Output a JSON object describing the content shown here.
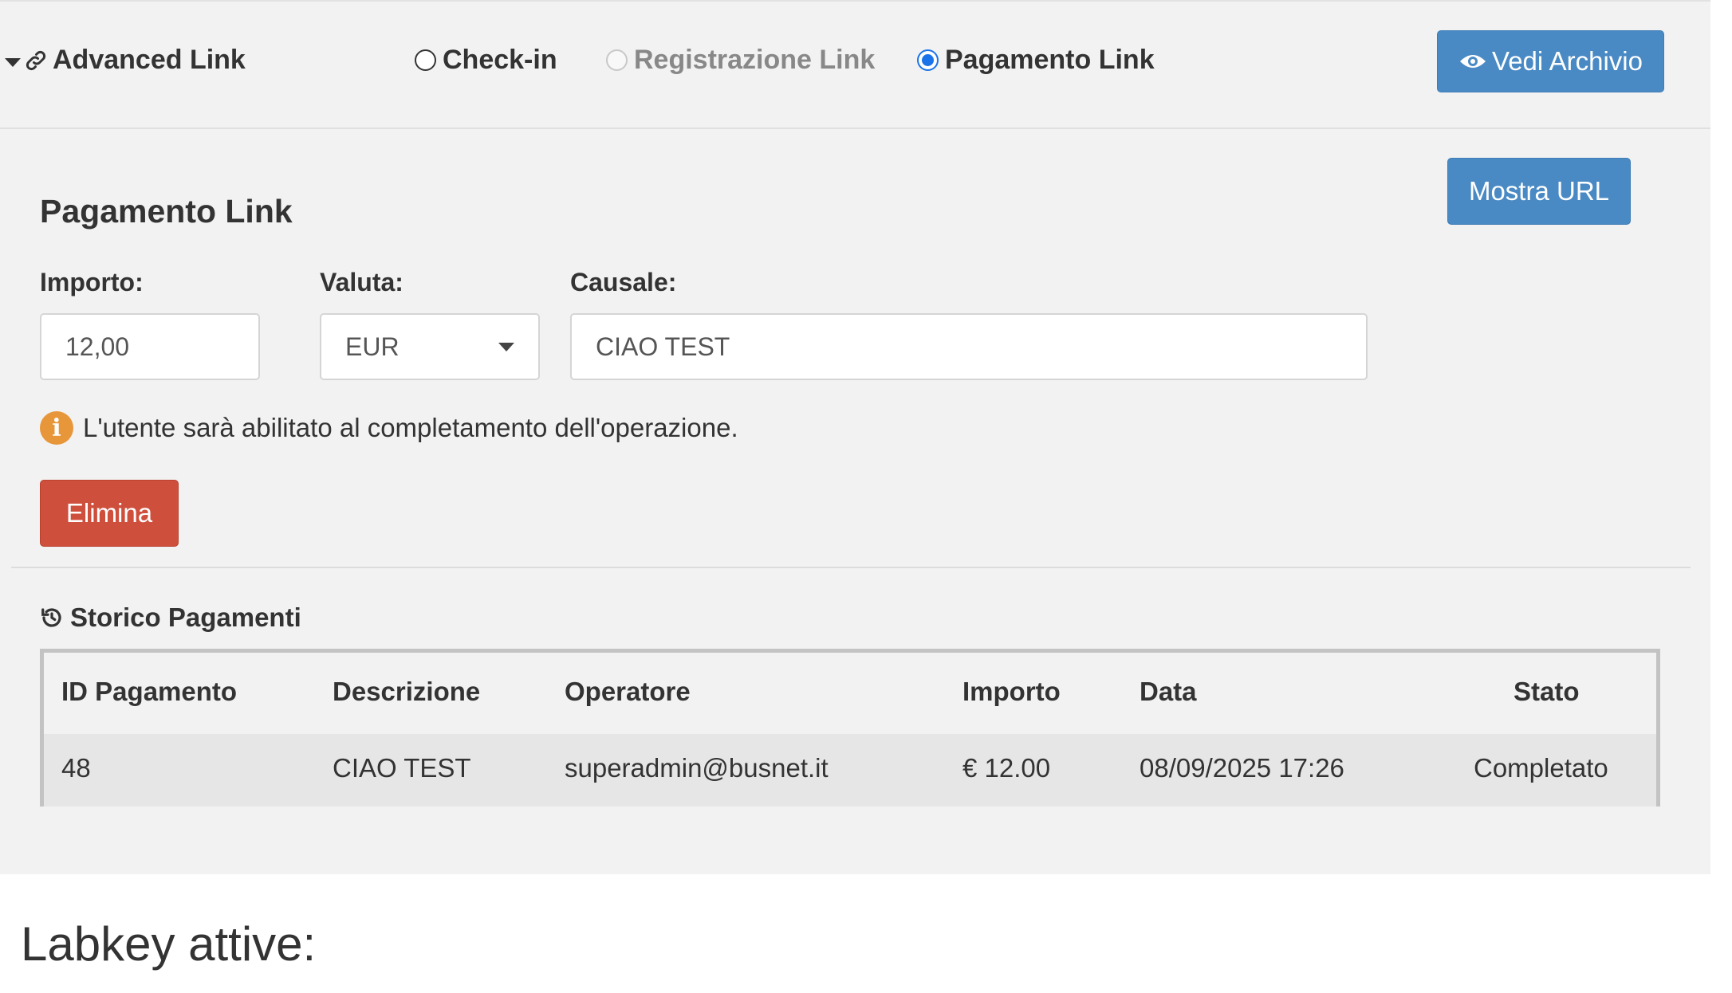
{
  "header": {
    "title": "Advanced Link",
    "options": [
      {
        "label": "Check-in",
        "state": "unchecked"
      },
      {
        "label": "Registrazione Link",
        "state": "disabled"
      },
      {
        "label": "Pagamento Link",
        "state": "checked"
      }
    ],
    "archive_button": "Vedi Archivio"
  },
  "form": {
    "title": "Pagamento Link",
    "show_url_button": "Mostra URL",
    "amount_label": "Importo:",
    "amount_value": "12,00",
    "currency_label": "Valuta:",
    "currency_value": "EUR",
    "reason_label": "Causale:",
    "reason_value": "CIAO TEST",
    "info_text": "L'utente sarà abilitato al completamento dell'operazione.",
    "delete_button": "Elimina"
  },
  "history": {
    "title": "Storico Pagamenti",
    "columns": [
      "ID Pagamento",
      "Descrizione",
      "Operatore",
      "Importo",
      "Data",
      "Stato"
    ],
    "rows": [
      [
        "48",
        "CIAO TEST",
        "superadmin@busnet.it",
        "€ 12.00",
        "08/09/2025 17:26",
        "Completato"
      ]
    ]
  },
  "footer": {
    "heading": "Labkey attive:"
  },
  "colors": {
    "primary": "#4a8ac4",
    "danger": "#cf4f3d",
    "info": "#e8963a",
    "radio_selected": "#1a73e8"
  }
}
